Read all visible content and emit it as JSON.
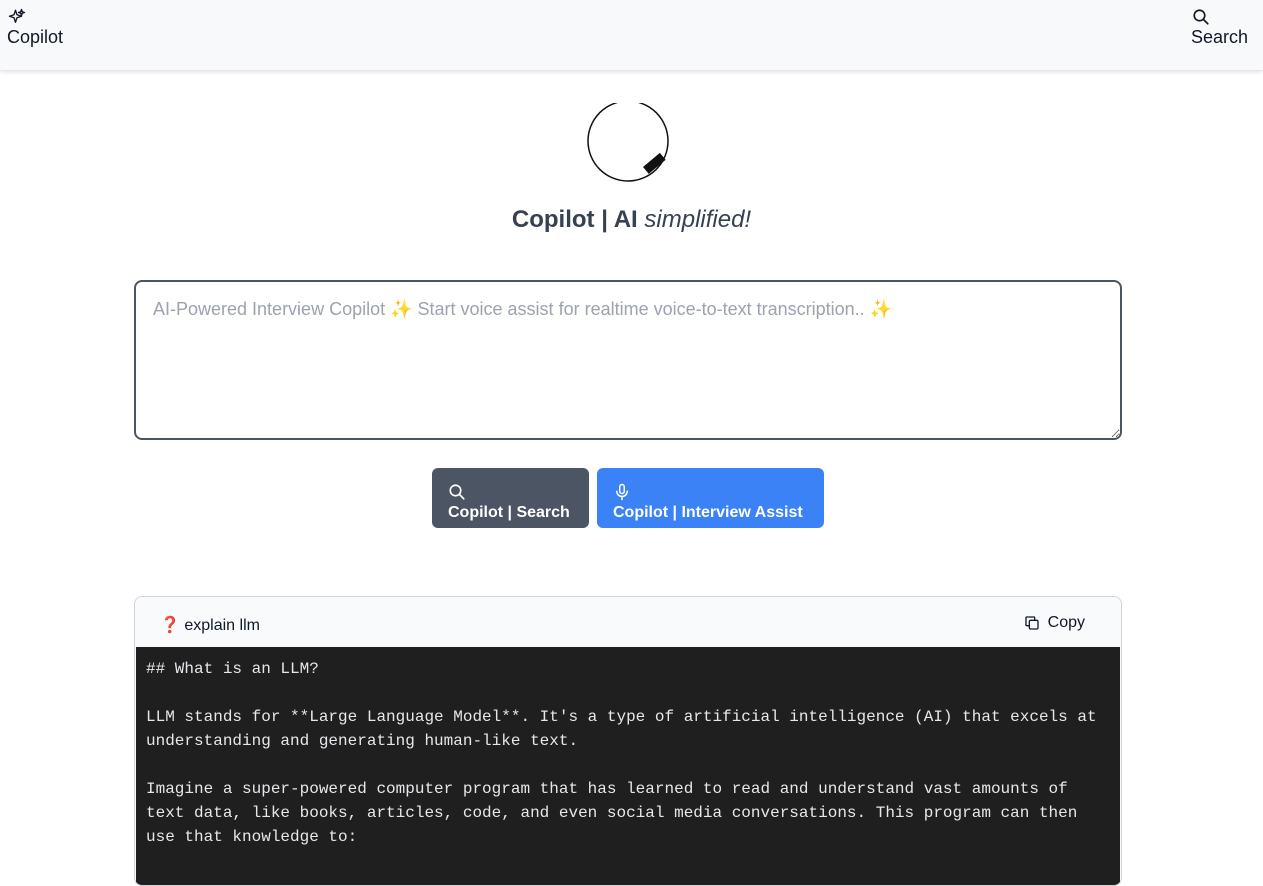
{
  "nav": {
    "left_label": "Copilot",
    "left_icon": "sparkles-icon",
    "right_label": "Search",
    "right_icon": "search-icon"
  },
  "brand": {
    "strong": "Copilot | AI",
    "em": "simplified!"
  },
  "prompt": {
    "placeholder": "AI-Powered Interview Copilot ✨ Start voice assist for realtime voice-to-text transcription.. ✨",
    "value": ""
  },
  "buttons": {
    "search_label": "Copilot | Search",
    "search_icon": "search-icon",
    "assist_label": "Copilot | Interview Assist",
    "assist_icon": "microphone-icon"
  },
  "answer": {
    "question": "❓ explain llm",
    "copy_label": "Copy",
    "content": "## What is an LLM?\n\nLLM stands for **Large Language Model**. It's a type of artificial intelligence (AI) that excels at understanding and generating human-like text.\n\nImagine a super-powered computer program that has learned to read and understand vast amounts of text data, like books, articles, code, and even social media conversations. This program can then use that knowledge to:"
  },
  "colors": {
    "search_button": "#4b5563",
    "assist_button": "#3b82f6",
    "code_background": "#1f1f1f"
  }
}
